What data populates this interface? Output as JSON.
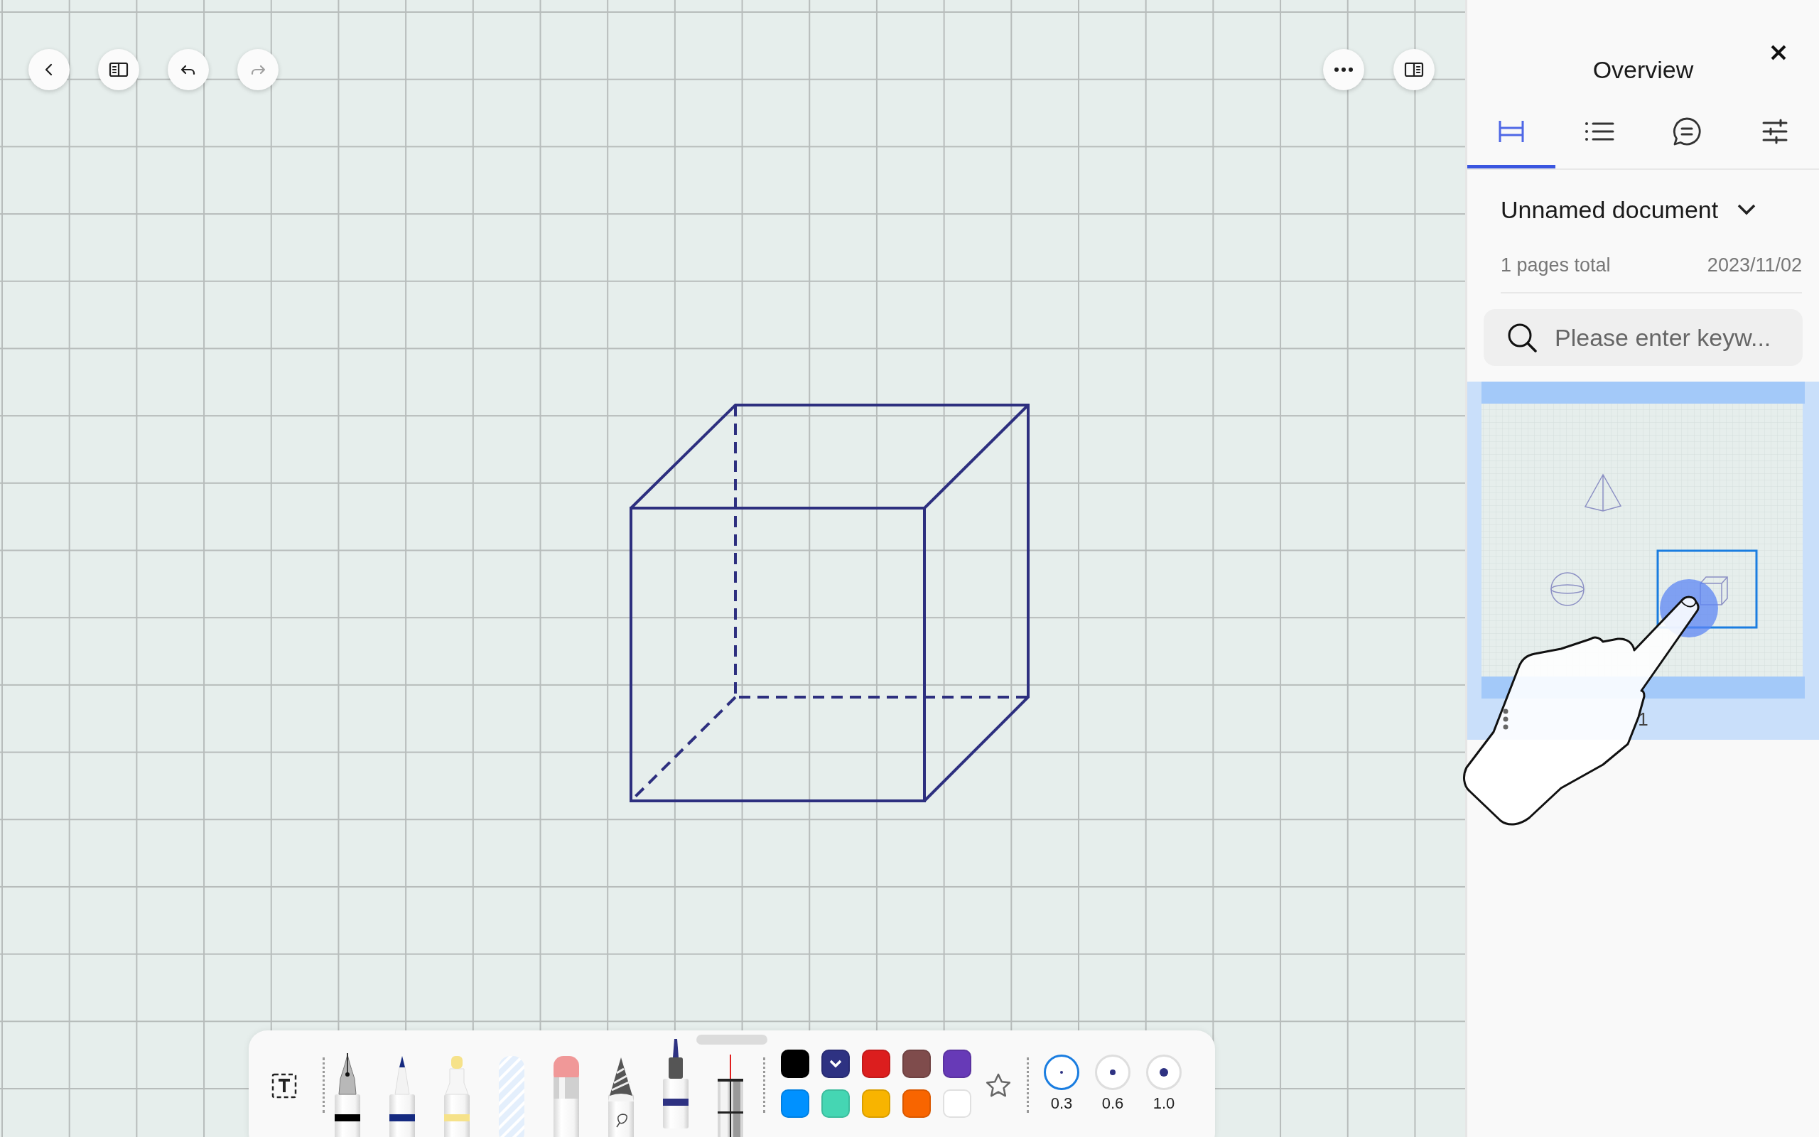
{
  "top_left_buttons": [
    {
      "kind": "back",
      "disabled": false
    },
    {
      "kind": "sidebar",
      "disabled": false
    },
    {
      "kind": "undo",
      "disabled": false
    },
    {
      "kind": "redo",
      "disabled": true
    }
  ],
  "top_right_buttons": [
    {
      "kind": "more",
      "disabled": false
    },
    {
      "kind": "panel",
      "disabled": false
    }
  ],
  "panel": {
    "title": "Overview",
    "tabs": [
      {
        "kind": "outline",
        "selected": true
      },
      {
        "kind": "list",
        "selected": false
      },
      {
        "kind": "comments",
        "selected": false
      },
      {
        "kind": "settings",
        "selected": false
      }
    ],
    "document": {
      "name": "Unnamed document",
      "page_count": "1 pages total",
      "date": "2023/11/02"
    },
    "search": {
      "placeholder": "Please enter keyw..."
    },
    "pages": [
      {
        "number": "1",
        "selected": true
      }
    ]
  },
  "toolbar": {
    "tools": [
      {
        "kind": "fountain_pen",
        "selected": false
      },
      {
        "kind": "ballpoint",
        "selected": false
      },
      {
        "kind": "highlighter",
        "selected": false
      },
      {
        "kind": "tape",
        "selected": false
      },
      {
        "kind": "eraser",
        "selected": false
      },
      {
        "kind": "lasso",
        "selected": false
      },
      {
        "kind": "marker",
        "selected": true
      },
      {
        "kind": "laser",
        "selected": false
      }
    ],
    "colors": [
      {
        "color": "#000000",
        "selected": false
      },
      {
        "color": "#2e3282",
        "selected": true
      },
      {
        "color": "#dc1e1e",
        "selected": false
      },
      {
        "color": "#7f4c4c",
        "selected": false
      },
      {
        "color": "#673ab7",
        "selected": false
      },
      {
        "color": "#0091ff",
        "selected": false
      },
      {
        "color": "#45d6b3",
        "selected": false
      },
      {
        "color": "#f8b400",
        "selected": false
      },
      {
        "color": "#f86500",
        "selected": false
      },
      {
        "color": "#ffffff",
        "selected": false
      }
    ],
    "thickness": [
      {
        "label": "0.3",
        "selected": true
      },
      {
        "label": "0.6",
        "selected": false
      },
      {
        "label": "1.0",
        "selected": false
      }
    ]
  }
}
